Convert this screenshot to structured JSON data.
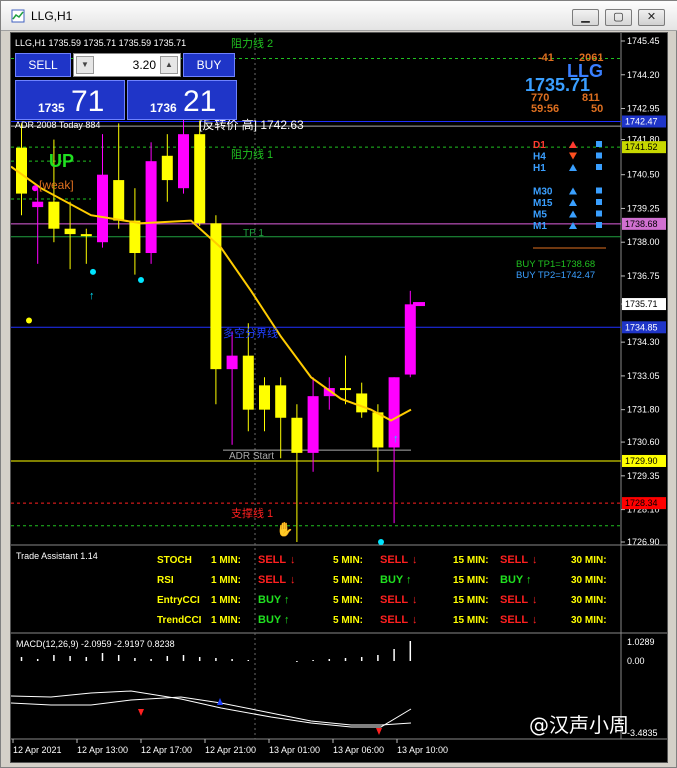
{
  "window": {
    "title": "LLG,H1",
    "buttons": [
      "minimize",
      "maximize",
      "close"
    ]
  },
  "trade_panel": {
    "sell_label": "SELL",
    "buy_label": "BUY",
    "lot_value": "3.20",
    "sell_price_small": "1735",
    "sell_price_big": "71",
    "buy_price_small": "1736",
    "buy_price_big": "21"
  },
  "chart_header": {
    "symbol_line": "LLG,H1  1735.59 1735.71 1735.59 1735.71",
    "adr_line": "ADR 2008  Today 884"
  },
  "top_right_stats": {
    "a": "-41",
    "b": "2061",
    "symbol": "LLG",
    "price": "1735.71",
    "c": "770",
    "d": "811",
    "e": "59:56",
    "f": "50"
  },
  "timeframe_signals": [
    {
      "tf": "D1",
      "color": "#ff3b30",
      "arrow": "up"
    },
    {
      "tf": "H4",
      "color": "#3aa0ff",
      "arrow": "down"
    },
    {
      "tf": "H1",
      "color": "#3aa0ff",
      "arrow": "up"
    },
    {
      "tf": "M30",
      "color": "#3aa0ff",
      "arrow": "up"
    },
    {
      "tf": "M15",
      "color": "#3aa0ff",
      "arrow": "up"
    },
    {
      "tf": "M5",
      "color": "#3aa0ff",
      "arrow": "up"
    },
    {
      "tf": "M1",
      "color": "#3aa0ff",
      "arrow": "up"
    }
  ],
  "targets": {
    "tp1": "BUY  TP1=1738.68",
    "tp2": "BUY  TP2=1742.47"
  },
  "chart_labels": {
    "resistance2": "阻力线 2",
    "resistance1": "阻力线 1",
    "reverse_price": "[反转价 高] 1742.63",
    "up_text": "UP",
    "weak_text": "[weak]",
    "tp1_label": "TP 1",
    "boundary": "多空分界线",
    "adr_start": "ADR Start",
    "support1": "支撑线 1"
  },
  "price_axis": {
    "ticks": [
      "1745.45",
      "1744.20",
      "1742.95",
      "1741.80",
      "1740.50",
      "1739.25",
      "1738.00",
      "1736.75",
      "1735.71",
      "1734.30",
      "1733.05",
      "1731.80",
      "1730.60",
      "1729.35",
      "1728.10",
      "1726.90"
    ],
    "badges": [
      {
        "label": "1742.47",
        "bg": "#1f35c8",
        "fg": "#ffffff"
      },
      {
        "label": "1741.52",
        "bg": "#c8d800",
        "fg": "#000000"
      },
      {
        "label": "1738.68",
        "bg": "#d070d0",
        "fg": "#000000"
      },
      {
        "label": "1735.71",
        "bg": "#ffffff",
        "fg": "#000000"
      },
      {
        "label": "1734.85",
        "bg": "#1f35c8",
        "fg": "#ffffff"
      },
      {
        "label": "1729.90",
        "bg": "#ffff00",
        "fg": "#000000"
      },
      {
        "label": "1728.34",
        "bg": "#ff0000",
        "fg": "#000000"
      }
    ]
  },
  "trade_assistant": {
    "title": "Trade Assistant 1.14",
    "rows": [
      {
        "name": "STOCH",
        "cells": [
          {
            "tf": "1 MIN:",
            "sig": "SELL",
            "color": "#ff2020"
          },
          {
            "tf": "5 MIN:",
            "sig": "SELL",
            "color": "#ff2020"
          },
          {
            "tf": "15 MIN:",
            "sig": "SELL",
            "color": "#ff2020"
          },
          {
            "tf": "30 MIN:",
            "sig": "",
            "color": "#ff2020"
          }
        ]
      },
      {
        "name": "RSI",
        "cells": [
          {
            "tf": "1 MIN:",
            "sig": "SELL",
            "color": "#ff2020"
          },
          {
            "tf": "5 MIN:",
            "sig": "BUY",
            "color": "#20e020"
          },
          {
            "tf": "15 MIN:",
            "sig": "BUY",
            "color": "#20e020"
          },
          {
            "tf": "30 MIN:",
            "sig": "",
            "color": "#20e020"
          }
        ]
      },
      {
        "name": "EntryCCI",
        "cells": [
          {
            "tf": "1 MIN:",
            "sig": "BUY",
            "color": "#20e020"
          },
          {
            "tf": "5 MIN:",
            "sig": "SELL",
            "color": "#ff2020"
          },
          {
            "tf": "15 MIN:",
            "sig": "SELL",
            "color": "#ff2020"
          },
          {
            "tf": "30 MIN:",
            "sig": "",
            "color": "#ff2020"
          }
        ]
      },
      {
        "name": "TrendCCI",
        "cells": [
          {
            "tf": "1 MIN:",
            "sig": "BUY",
            "color": "#20e020"
          },
          {
            "tf": "5 MIN:",
            "sig": "SELL",
            "color": "#ff2020"
          },
          {
            "tf": "15 MIN:",
            "sig": "SELL",
            "color": "#ff2020"
          },
          {
            "tf": "30 MIN:",
            "sig": "",
            "color": "#ff2020"
          }
        ]
      }
    ]
  },
  "macd": {
    "label": "MACD(12,26,9) -2.0959 -2.9197 0.8238",
    "ticks": [
      "1.0289",
      "0.00",
      "-3.4835"
    ]
  },
  "time_axis": [
    "12 Apr 2021",
    "12 Apr 13:00",
    "12 Apr 17:00",
    "12 Apr 21:00",
    "13 Apr 01:00",
    "13 Apr 06:00",
    "13 Apr 10:00"
  ],
  "watermark": "@汉声小周",
  "candles": [
    {
      "o": 1741.5,
      "h": 1742.4,
      "l": 1739.0,
      "c": 1739.8,
      "color": "#ffff00"
    },
    {
      "o": 1739.3,
      "h": 1740.0,
      "l": 1737.2,
      "c": 1739.5,
      "color": "#ff00ff"
    },
    {
      "o": 1739.5,
      "h": 1741.8,
      "l": 1738.0,
      "c": 1738.5,
      "color": "#ffff00"
    },
    {
      "o": 1738.5,
      "h": 1739.5,
      "l": 1737.0,
      "c": 1738.3,
      "color": "#ffff00"
    },
    {
      "o": 1738.3,
      "h": 1738.5,
      "l": 1737.2,
      "c": 1738.3,
      "color": "#ffff00"
    },
    {
      "o": 1738.0,
      "h": 1742.0,
      "l": 1737.8,
      "c": 1740.5,
      "color": "#ff00ff"
    },
    {
      "o": 1740.3,
      "h": 1742.4,
      "l": 1738.5,
      "c": 1738.8,
      "color": "#ffff00"
    },
    {
      "o": 1738.8,
      "h": 1740.0,
      "l": 1736.8,
      "c": 1737.6,
      "color": "#ffff00"
    },
    {
      "o": 1737.6,
      "h": 1741.7,
      "l": 1737.2,
      "c": 1741.0,
      "color": "#ff00ff"
    },
    {
      "o": 1740.3,
      "h": 1742.0,
      "l": 1739.5,
      "c": 1741.2,
      "color": "#ffff00"
    },
    {
      "o": 1740.0,
      "h": 1742.6,
      "l": 1739.8,
      "c": 1742.0,
      "color": "#ff00ff"
    },
    {
      "o": 1742.0,
      "h": 1742.5,
      "l": 1738.6,
      "c": 1738.7,
      "color": "#ffff00"
    },
    {
      "o": 1738.7,
      "h": 1739.0,
      "l": 1732.0,
      "c": 1733.3,
      "color": "#ffff00"
    },
    {
      "o": 1733.3,
      "h": 1734.7,
      "l": 1730.5,
      "c": 1733.8,
      "color": "#ff00ff"
    },
    {
      "o": 1733.8,
      "h": 1735.0,
      "l": 1731.0,
      "c": 1731.8,
      "color": "#ffff00"
    },
    {
      "o": 1731.8,
      "h": 1733.0,
      "l": 1731.0,
      "c": 1732.7,
      "color": "#ffff00"
    },
    {
      "o": 1732.7,
      "h": 1733.0,
      "l": 1730.0,
      "c": 1731.5,
      "color": "#ffff00"
    },
    {
      "o": 1731.5,
      "h": 1732.0,
      "l": 1726.9,
      "c": 1730.2,
      "color": "#ffff00"
    },
    {
      "o": 1730.2,
      "h": 1733.0,
      "l": 1729.5,
      "c": 1732.3,
      "color": "#ff00ff"
    },
    {
      "o": 1732.3,
      "h": 1733.0,
      "l": 1731.8,
      "c": 1732.6,
      "color": "#ff00ff"
    },
    {
      "o": 1732.6,
      "h": 1733.8,
      "l": 1732.0,
      "c": 1732.6,
      "color": "#ffff00"
    },
    {
      "o": 1732.4,
      "h": 1732.8,
      "l": 1731.5,
      "c": 1731.7,
      "color": "#ffff00"
    },
    {
      "o": 1731.7,
      "h": 1732.0,
      "l": 1729.5,
      "c": 1730.4,
      "color": "#ffff00"
    },
    {
      "o": 1730.4,
      "h": 1733.0,
      "l": 1727.6,
      "c": 1733.0,
      "color": "#ff00ff"
    },
    {
      "o": 1733.1,
      "h": 1736.2,
      "l": 1733.0,
      "c": 1735.7,
      "color": "#ff00ff"
    }
  ]
}
